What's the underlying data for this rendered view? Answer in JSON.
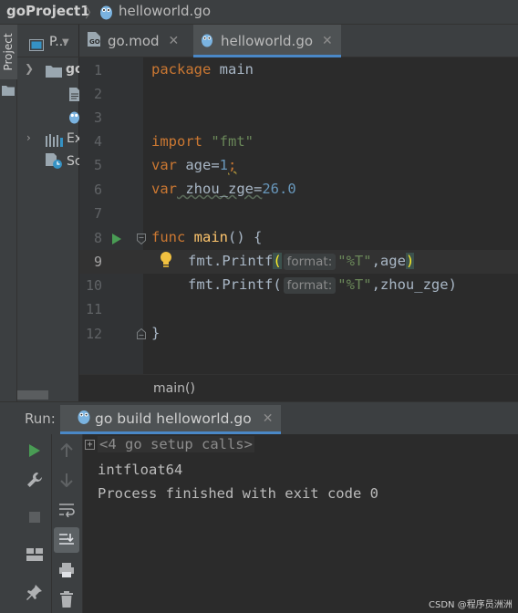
{
  "breadcrumb": {
    "project": "goProject1",
    "file": "helloworld.go"
  },
  "left_strip": {
    "project_tab": "Project"
  },
  "project_panel": {
    "title": "P...",
    "tree": [
      {
        "label": "go",
        "icon": "folder-icon"
      },
      {
        "label": "",
        "icon": "file-icon"
      },
      {
        "label": "",
        "icon": "gopher-file-icon"
      },
      {
        "label": "Ex",
        "icon": "libraries-icon"
      },
      {
        "label": "Sc",
        "icon": "scratches-icon"
      }
    ]
  },
  "editor": {
    "tabs": [
      {
        "label": "go.mod",
        "active": false
      },
      {
        "label": "helloworld.go",
        "active": true
      }
    ],
    "line_numbers": [
      "1",
      "2",
      "3",
      "4",
      "5",
      "6",
      "7",
      "8",
      "9",
      "10",
      "11",
      "12"
    ],
    "lines": {
      "l1_kw": "package",
      "l1_rest": " main",
      "l4_kw": "import",
      "l4_str": "\"fmt\"",
      "l5_kw": "var",
      "l5_name": " age=",
      "l5_num": "1",
      "l5_semi": ";",
      "l6_kw": "var",
      "l6_name": " zhou_zge=",
      "l6_num": "26.0",
      "l8_kw": "func",
      "l8_fn": "main",
      "l8_rest": "() {",
      "l9_pre": "fmt.Printf",
      "l9_open": "(",
      "l9_hint": "format:",
      "l9_str": "\"%T\"",
      "l9_args": ",age",
      "l9_close": ")",
      "l10_pre": "fmt.Printf",
      "l10_open": "(",
      "l10_hint": "format:",
      "l10_str": "\"%T\"",
      "l10_args": ",zhou_zge)",
      "l12": "}"
    },
    "function_breadcrumb": "main()"
  },
  "run_panel": {
    "label": "Run:",
    "tab": "go build helloworld.go",
    "console": {
      "setup": "<4 go setup calls>",
      "output": "intfloat64",
      "exit": "Process finished with exit code 0"
    }
  },
  "watermark": "CSDN @程序员洲洲",
  "colors": {
    "keyword": "#cc7832",
    "string": "#6a8759",
    "number": "#6897bb",
    "function": "#ffc66d",
    "accent": "#4a88c7",
    "run_green": "#499c54"
  }
}
